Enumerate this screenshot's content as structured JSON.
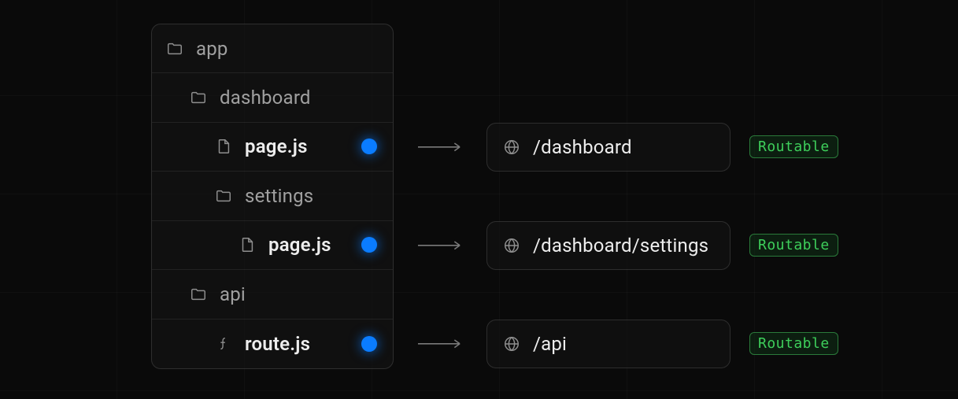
{
  "tree": [
    {
      "type": "folder",
      "label": "app",
      "depth": 0,
      "strong": false,
      "routable": false
    },
    {
      "type": "folder",
      "label": "dashboard",
      "depth": 1,
      "strong": false,
      "routable": false
    },
    {
      "type": "file",
      "label": "page.js",
      "depth": 2,
      "strong": true,
      "routable": true,
      "url": "/dashboard"
    },
    {
      "type": "folder",
      "label": "settings",
      "depth": 2,
      "strong": false,
      "routable": false
    },
    {
      "type": "file",
      "label": "page.js",
      "depth": 3,
      "strong": true,
      "routable": true,
      "url": "/dashboard/settings"
    },
    {
      "type": "folder",
      "label": "api",
      "depth": 1,
      "strong": false,
      "routable": false
    },
    {
      "type": "route",
      "label": "route.js",
      "depth": 2,
      "strong": true,
      "routable": true,
      "url": "/api"
    }
  ],
  "badge_label": "Routable",
  "colors": {
    "background": "#0a0a0a",
    "border": "rgba(255,255,255,0.13)",
    "text_muted": "#a0a0a0",
    "text_strong": "#ededed",
    "dot": "#0a7cff",
    "badge_border": "#2a7a3a",
    "badge_text": "#3ecf5b"
  }
}
